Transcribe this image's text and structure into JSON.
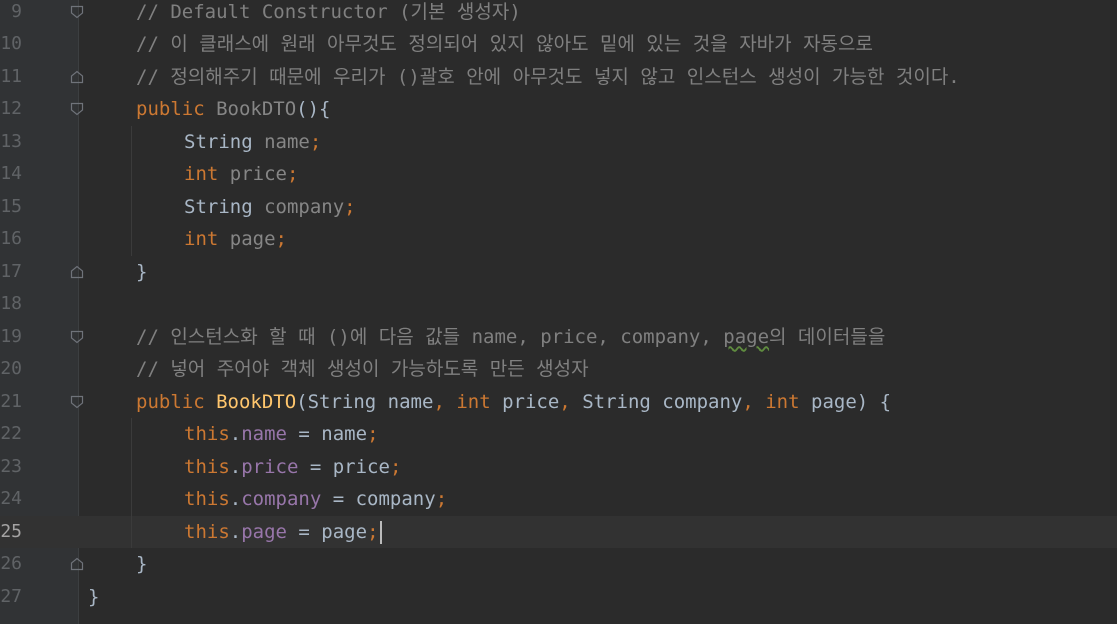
{
  "editor": {
    "current_line": "25",
    "lines": [
      {
        "num": "9",
        "fold": "fold-start",
        "indent": 1,
        "tokens": [
          {
            "t": "// Default Constructor (기본 생성자)",
            "c": "cm"
          }
        ]
      },
      {
        "num": "10",
        "fold": "",
        "indent": 1,
        "tokens": [
          {
            "t": "// 이 클래스에 원래 아무것도 정의되어 있지 않아도 밑에 있는 것을 자바가 자동으로",
            "c": "cm"
          }
        ]
      },
      {
        "num": "11",
        "fold": "fold-end",
        "indent": 1,
        "tokens": [
          {
            "t": "// 정의해주기 때문에 우리가 ()괄호 안에 아무것도 넣지 않고 인스턴스 생성이 가능한 것이다.",
            "c": "cm"
          }
        ]
      },
      {
        "num": "12",
        "fold": "fold-start",
        "indent": 1,
        "tokens": [
          {
            "t": "public ",
            "c": "kw"
          },
          {
            "t": "BookDTO",
            "c": "dim"
          },
          {
            "t": "(){",
            "c": "tx"
          }
        ]
      },
      {
        "num": "13",
        "fold": "",
        "indent": 2,
        "tokens": [
          {
            "t": "String ",
            "c": "tx"
          },
          {
            "t": "name",
            "c": "dim"
          },
          {
            "t": ";",
            "c": "kw"
          }
        ]
      },
      {
        "num": "14",
        "fold": "",
        "indent": 2,
        "tokens": [
          {
            "t": "int ",
            "c": "kw"
          },
          {
            "t": "price",
            "c": "dim"
          },
          {
            "t": ";",
            "c": "kw"
          }
        ]
      },
      {
        "num": "15",
        "fold": "",
        "indent": 2,
        "tokens": [
          {
            "t": "String ",
            "c": "tx"
          },
          {
            "t": "company",
            "c": "dim"
          },
          {
            "t": ";",
            "c": "kw"
          }
        ]
      },
      {
        "num": "16",
        "fold": "",
        "indent": 2,
        "tokens": [
          {
            "t": "int ",
            "c": "kw"
          },
          {
            "t": "page",
            "c": "dim"
          },
          {
            "t": ";",
            "c": "kw"
          }
        ]
      },
      {
        "num": "17",
        "fold": "fold-end",
        "indent": 1,
        "tokens": [
          {
            "t": "}",
            "c": "tx"
          }
        ]
      },
      {
        "num": "18",
        "fold": "",
        "indent": 0,
        "tokens": []
      },
      {
        "num": "19",
        "fold": "fold-start",
        "indent": 1,
        "tokens": [
          {
            "t": "// 인스턴스화 할 때 ()에 다음 값들 name, price, company, ",
            "c": "cm"
          },
          {
            "t": "page",
            "c": "cm",
            "squig": true
          },
          {
            "t": "의 데이터들을",
            "c": "cm"
          }
        ]
      },
      {
        "num": "20",
        "fold": "",
        "indent": 1,
        "tokens": [
          {
            "t": "// 넣어 주어야 객체 생성이 가능하도록 만든 생성자",
            "c": "cm"
          }
        ]
      },
      {
        "num": "21",
        "fold": "fold-start",
        "indent": 1,
        "tokens": [
          {
            "t": "public ",
            "c": "kw"
          },
          {
            "t": "BookDTO",
            "c": "fn"
          },
          {
            "t": "(String name",
            "c": "tx"
          },
          {
            "t": ", ",
            "c": "kw"
          },
          {
            "t": "int ",
            "c": "kw"
          },
          {
            "t": "price",
            "c": "tx"
          },
          {
            "t": ", ",
            "c": "kw"
          },
          {
            "t": "String company",
            "c": "tx"
          },
          {
            "t": ", ",
            "c": "kw"
          },
          {
            "t": "int ",
            "c": "kw"
          },
          {
            "t": "page) {",
            "c": "tx"
          }
        ]
      },
      {
        "num": "22",
        "fold": "",
        "indent": 2,
        "tokens": [
          {
            "t": "this",
            "c": "kw"
          },
          {
            "t": ".",
            "c": "tx"
          },
          {
            "t": "name",
            "c": "fld"
          },
          {
            "t": " = name",
            "c": "tx"
          },
          {
            "t": ";",
            "c": "kw"
          }
        ]
      },
      {
        "num": "23",
        "fold": "",
        "indent": 2,
        "tokens": [
          {
            "t": "this",
            "c": "kw"
          },
          {
            "t": ".",
            "c": "tx"
          },
          {
            "t": "price",
            "c": "fld"
          },
          {
            "t": " = price",
            "c": "tx"
          },
          {
            "t": ";",
            "c": "kw"
          }
        ]
      },
      {
        "num": "24",
        "fold": "",
        "indent": 2,
        "tokens": [
          {
            "t": "this",
            "c": "kw"
          },
          {
            "t": ".",
            "c": "tx"
          },
          {
            "t": "company",
            "c": "fld"
          },
          {
            "t": " = company",
            "c": "tx"
          },
          {
            "t": ";",
            "c": "kw"
          }
        ]
      },
      {
        "num": "25",
        "fold": "",
        "indent": 2,
        "tokens": [
          {
            "t": "this",
            "c": "kw"
          },
          {
            "t": ".",
            "c": "tx"
          },
          {
            "t": "page",
            "c": "fld"
          },
          {
            "t": " = page",
            "c": "tx"
          },
          {
            "t": ";",
            "c": "kw"
          }
        ]
      },
      {
        "num": "26",
        "fold": "fold-end",
        "indent": 1,
        "tokens": [
          {
            "t": "}",
            "c": "tx"
          }
        ]
      },
      {
        "num": "27",
        "fold": "",
        "indent": 0,
        "tokens": [
          {
            "t": "}",
            "c": "tx"
          }
        ]
      }
    ]
  },
  "colors": {
    "background": "#2b2b2b",
    "keyword": "#cc7832",
    "comment": "#808080",
    "field": "#9876aa",
    "method": "#ffc66d",
    "text": "#a9b7c6"
  }
}
